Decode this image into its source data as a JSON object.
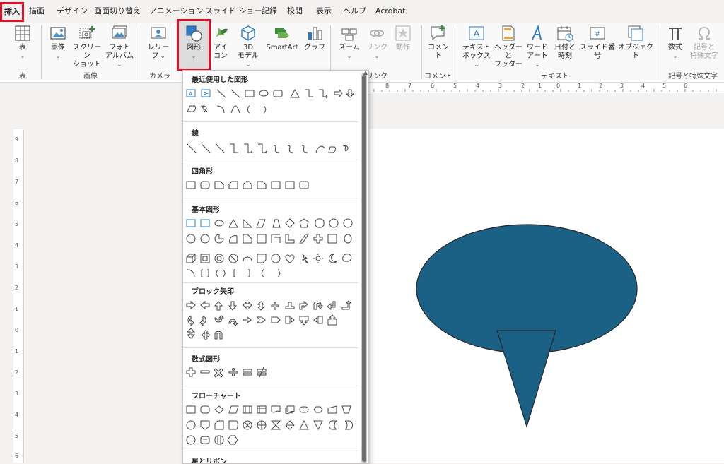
{
  "tabs": [
    "挿入",
    "描画",
    "デザイン",
    "画面切り替え",
    "アニメーション",
    "スライド ショー",
    "記録",
    "校閲",
    "表示",
    "ヘルプ",
    "Acrobat"
  ],
  "ribbon": {
    "table": {
      "label": "表",
      "group": "表"
    },
    "images": {
      "picture": "画像",
      "screenshot_l1": "スクリーン",
      "screenshot_l2": "ショット",
      "album_l1": "フォト",
      "album_l2": "アルバム",
      "group": "画像"
    },
    "camera": {
      "cameo_l1": "レリー",
      "cameo_l2": "フ",
      "group": "カメラ"
    },
    "illustrations": {
      "shapes": "図形",
      "icons_l1": "アイ",
      "icons_l2": "コン",
      "model_l1": "3D",
      "model_l2": "モデル",
      "smartart": "SmartArt",
      "chart": "グラフ"
    },
    "links": {
      "zoom": "ズーム",
      "link": "リンク",
      "action": "動作",
      "group": "リンク"
    },
    "comments": {
      "comment": "コメント",
      "group": "コメント"
    },
    "text": {
      "textbox_l1": "テキスト",
      "textbox_l2": "ボックス",
      "header_l1": "ヘッダーと",
      "header_l2": "フッター",
      "wordart_l1": "ワード",
      "wordart_l2": "アート",
      "datetime_l1": "日付と",
      "datetime_l2": "時刻",
      "slideno": "スライド番号",
      "object": "オブジェクト",
      "group": "テキスト"
    },
    "symbols": {
      "equation": "数式",
      "symbol_l1": "記号と",
      "symbol_l2": "特殊文字",
      "group": "記号と特殊文字"
    }
  },
  "shapes_menu": {
    "sections": [
      "最近使用した図形",
      "線",
      "四角形",
      "基本図形",
      "ブロック矢印",
      "数式図形",
      "フローチャート",
      "星とリボン"
    ]
  },
  "rulers": {
    "top_ticks": [
      "8",
      "7",
      "6",
      "5",
      "4",
      "3",
      "2",
      "1",
      "0",
      "1",
      "2",
      "3",
      "4",
      "5",
      "6"
    ],
    "left_ticks": [
      "9",
      "8",
      "7",
      "6",
      "5",
      "4",
      "3",
      "2",
      "1",
      "0",
      "1",
      "2",
      "3",
      "4",
      "5",
      "6"
    ]
  },
  "colors": {
    "accent_red": "#e0102a",
    "callout_fill": "#1b6186",
    "shape_outline": "#262626"
  }
}
